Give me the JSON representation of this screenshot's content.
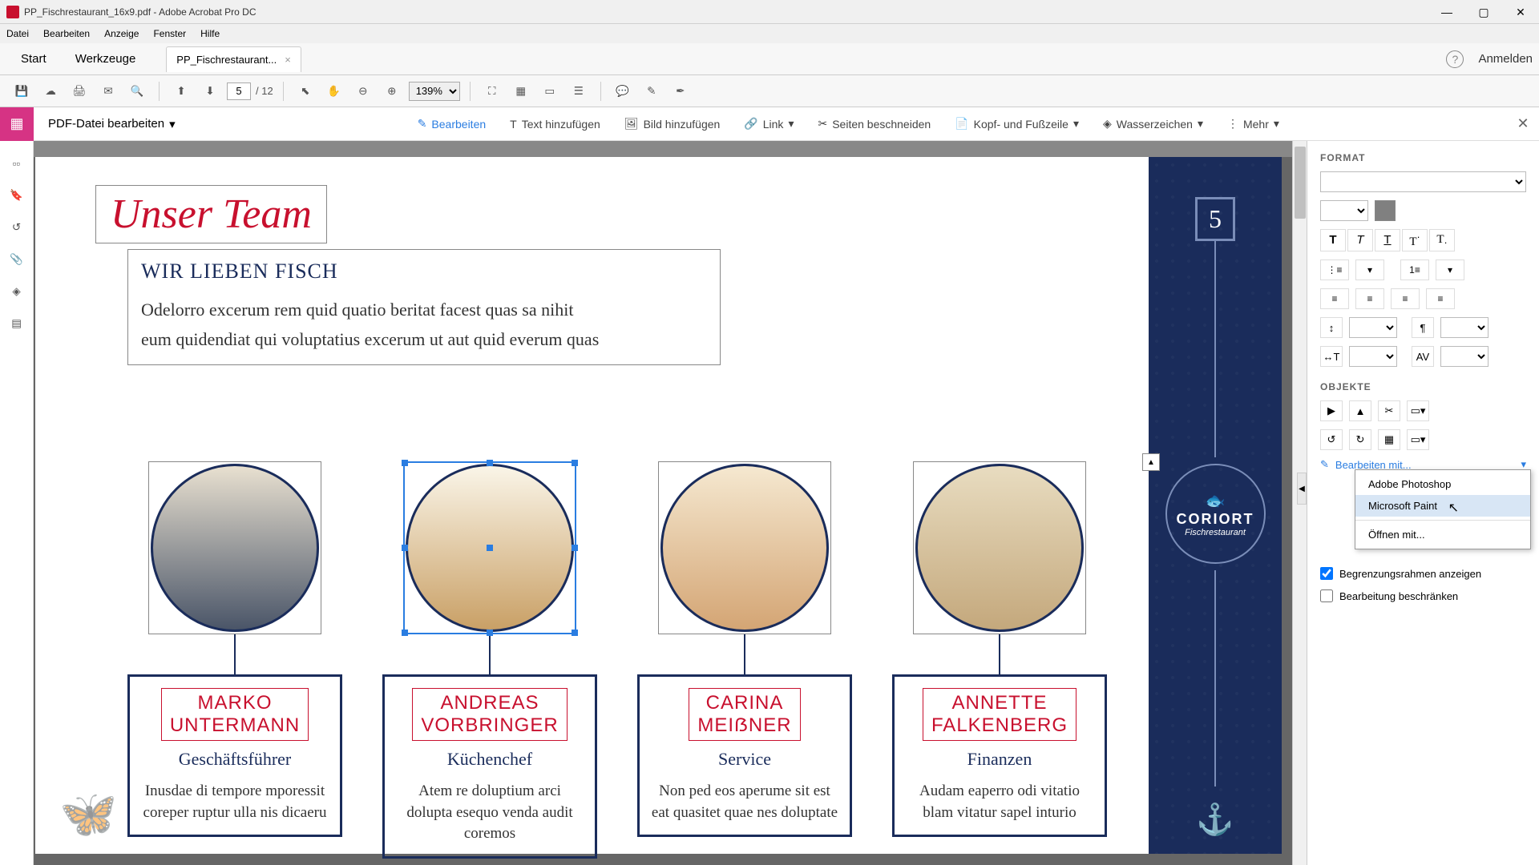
{
  "titlebar": {
    "text": "PP_Fischrestaurant_16x9.pdf - Adobe Acrobat Pro DC"
  },
  "menu": {
    "file": "Datei",
    "edit": "Bearbeiten",
    "view": "Anzeige",
    "window": "Fenster",
    "help": "Hilfe"
  },
  "tabs": {
    "start": "Start",
    "tools": "Werkzeuge",
    "doc": "PP_Fischrestaurant...",
    "signin": "Anmelden"
  },
  "toolbar": {
    "page_current": "5",
    "page_total": "12",
    "zoom": "139%"
  },
  "editbar": {
    "title": "PDF-Datei bearbeiten",
    "tools": {
      "edit": "Bearbeiten",
      "addtext": "Text hinzufügen",
      "addimage": "Bild hinzufügen",
      "link": "Link",
      "crop": "Seiten beschneiden",
      "headerfooter": "Kopf- und Fußzeile",
      "watermark": "Wasserzeichen",
      "more": "Mehr"
    }
  },
  "page": {
    "script_title": "Unser Team",
    "subhead": "WIR LIEBEN FISCH",
    "body1": "Odelorro excerum rem quid quatio beritat facest quas sa nihit",
    "body2": "eum quidendiat qui voluptatius excerum ut aut quid everum quas",
    "pagenum": "5",
    "brand": "CORIORT",
    "brand_sub": "Fischrestaurant",
    "members": [
      {
        "name1": "MARKO",
        "name2": "UNTERMANN",
        "role": "Geschäftsführer",
        "desc": "Inusdae di tempore mporessit coreper ruptur ulla nis dicaeru"
      },
      {
        "name1": "ANDREAS",
        "name2": "VORBRINGER",
        "role": "Küchenchef",
        "desc": "Atem re doluptium arci dolupta esequo venda audit coremos"
      },
      {
        "name1": "CARINA",
        "name2": "MEIẞNER",
        "role": "Service",
        "desc": "Non ped eos aperume sit est eat quasitet quae nes doluptate"
      },
      {
        "name1": "ANNETTE",
        "name2": "FALKENBERG",
        "role": "Finanzen",
        "desc": "Audam eaperro odi vitatio blam vitatur sapel inturio"
      }
    ]
  },
  "format": {
    "heading": "FORMAT",
    "objects_heading": "OBJEKTE",
    "edit_with": "Bearbeiten mit...",
    "dropdown": {
      "photoshop": "Adobe Photoshop",
      "paint": "Microsoft Paint",
      "openwith": "Öffnen mit..."
    },
    "show_bounds": "Begrenzungsrahmen anzeigen",
    "restrict_edit": "Bearbeitung beschränken"
  }
}
